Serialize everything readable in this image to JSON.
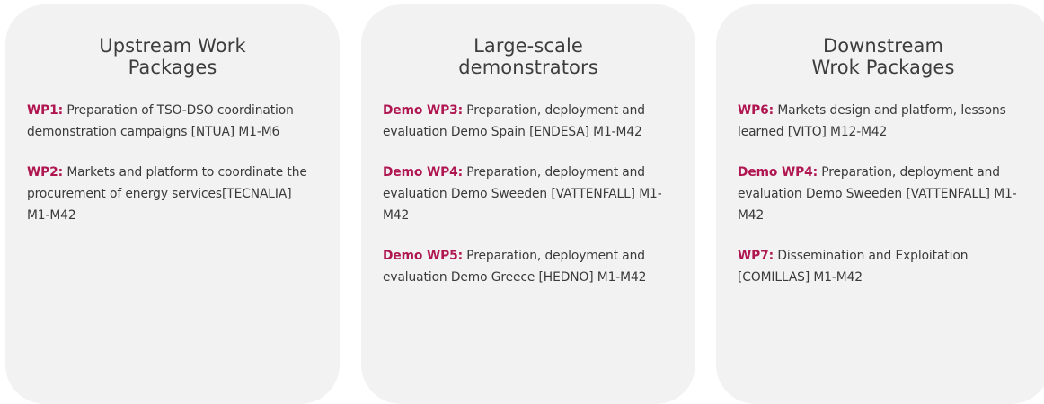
{
  "colors": {
    "card_background": "#f2f2f3",
    "code_accent": "#b01650",
    "title_text": "#3d3d3d",
    "body_text": "#3a3a3a"
  },
  "cards": [
    {
      "title": "Upstream Work\nPackages",
      "items": [
        {
          "code": "WP1:",
          "text": " Preparation of TSO-DSO coordination demonstration campaigns [NTUA] M1-M6"
        },
        {
          "code": "WP2:",
          "text": " Markets and platform to coordinate the procurement of energy services[TECNALIA] M1-M42"
        }
      ]
    },
    {
      "title": "Large-scale\ndemonstrators",
      "items": [
        {
          "code": "Demo WP3:",
          "text": " Preparation, deployment and evaluation Demo Spain [ENDESA] M1-M42"
        },
        {
          "code": "Demo WP4:",
          "text": " Preparation, deployment and evaluation Demo Sweeden [VATTENFALL] M1-M42"
        },
        {
          "code": "Demo WP5:",
          "text": " Preparation, deployment and evaluation Demo Greece [HEDNO] M1-M42"
        }
      ]
    },
    {
      "title": "Downstream\nWrok Packages",
      "items": [
        {
          "code": "WP6:",
          "text": " Markets design and platform, lessons learned [VITO] M12-M42"
        },
        {
          "code": "Demo WP4:",
          "text": " Preparation, deployment and evaluation Demo Sweeden [VATTENFALL] M1-M42"
        },
        {
          "code": "WP7:",
          "text": " Dissemination and Exploitation [COMILLAS] M1-M42"
        }
      ]
    }
  ]
}
